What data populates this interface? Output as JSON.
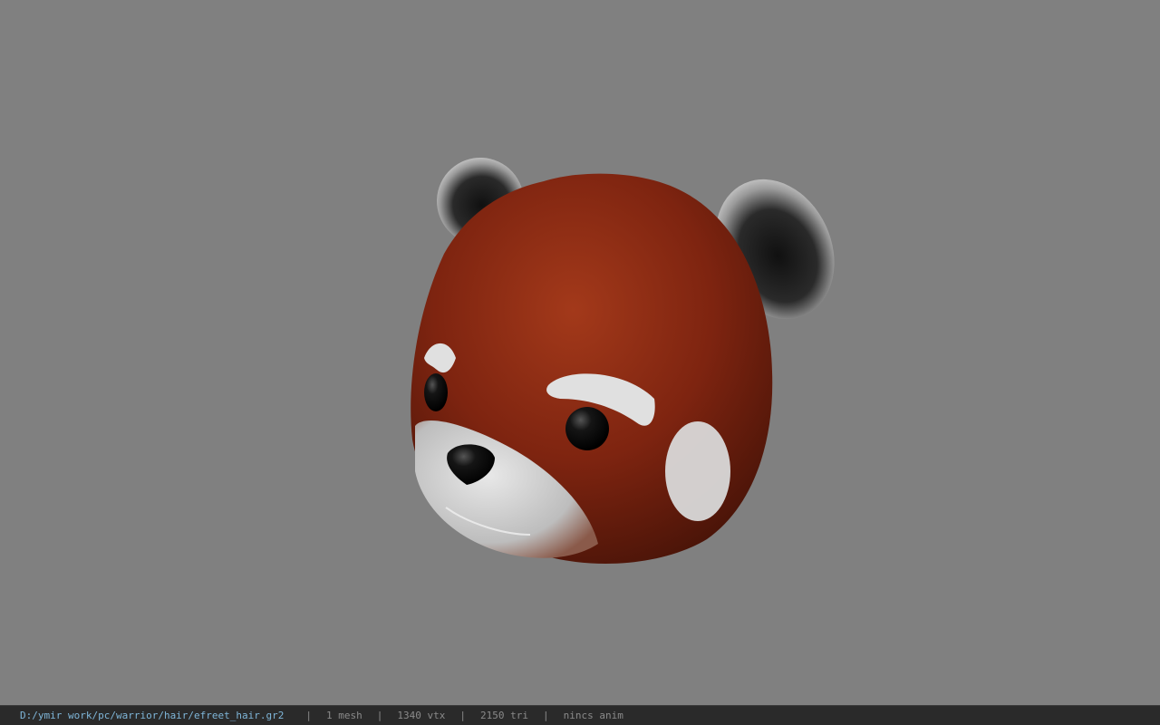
{
  "viewer": {
    "background_color": "#808080",
    "model": {
      "description_icon": "red-panda-head-model",
      "fur_color": "#8a2a12",
      "marking_color": "#e6e6e6",
      "eye_color": "#111111"
    }
  },
  "status": {
    "file_path": "D:/ymir work/pc/warrior/hair/efreet_hair.gr2",
    "separator": "|",
    "mesh_count": "1 mesh",
    "vertex_count": "1340 vtx",
    "triangle_count": "2150 tri",
    "anim_info": "nincs anim"
  }
}
